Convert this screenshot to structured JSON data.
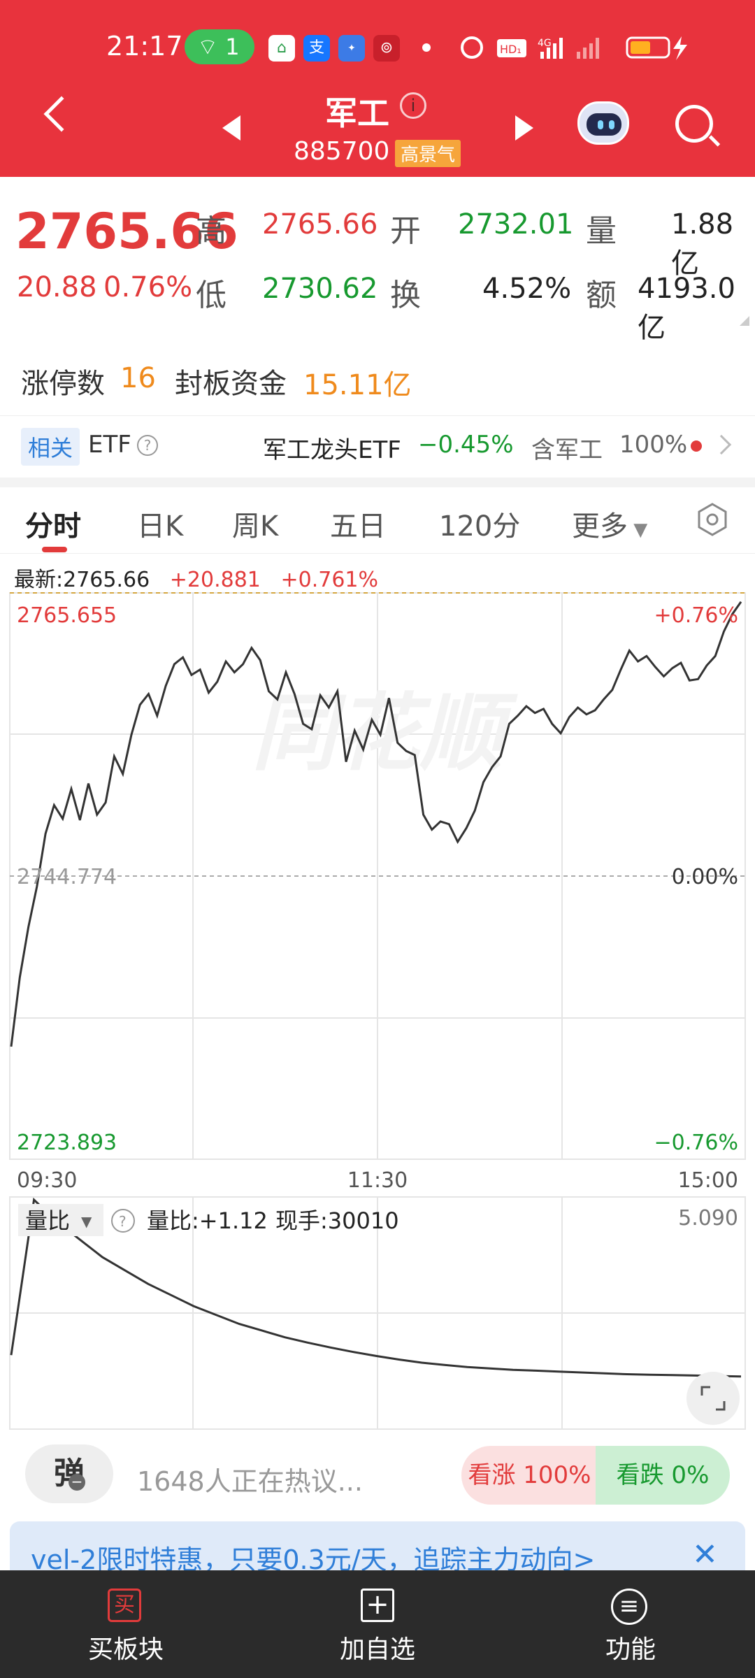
{
  "status_bar": {
    "time": "21:17",
    "wifi_count": "1"
  },
  "header": {
    "title": "军工",
    "code": "885700",
    "tag": "高景气"
  },
  "quote": {
    "price": "2765.66",
    "change": "20.88",
    "change_pct": "0.76%",
    "high_label": "高",
    "high": "2765.66",
    "low_label": "低",
    "low": "2730.62",
    "open_label": "开",
    "open": "2732.01",
    "turnover_label": "换",
    "turnover": "4.52%",
    "volume_label": "量",
    "volume": "1.88亿",
    "amount_label": "额",
    "amount": "4193.0亿"
  },
  "limit_up": {
    "count_label": "涨停数",
    "count": "16",
    "fund_label": "封板资金",
    "fund": "15.11亿"
  },
  "etf": {
    "related_label": "相关",
    "etf_label": "ETF",
    "name": "军工龙头ETF",
    "change": "−0.45%",
    "contains_label": "含军工",
    "contains_pct": "100%"
  },
  "tabs": [
    "分时",
    "日K",
    "周K",
    "五日",
    "120分",
    "更多"
  ],
  "latest": {
    "label": "最新:2765.66",
    "change": "+20.881",
    "pct": "+0.761%"
  },
  "chart_data": [
    {
      "type": "line",
      "title": "分时",
      "x_ticks": [
        "09:30",
        "11:30",
        "15:00"
      ],
      "y_top_label": "2765.655",
      "y_mid_label": "2744.774",
      "y_bottom_label": "2723.893",
      "right_top_label": "+0.76%",
      "right_mid_label": "0.00%",
      "right_bottom_label": "−0.76%",
      "ylim": [
        2723.893,
        2765.655
      ],
      "base": 2744.774,
      "series": [
        {
          "values": [
            2732.2,
            2737.3,
            2741.0,
            2744.0,
            2747.9,
            2750.0,
            2749.0,
            2751.2,
            2748.9,
            2751.6,
            2749.3,
            2750.2,
            2753.6,
            2752.3,
            2755.2,
            2757.4,
            2758.2,
            2756.6,
            2758.8,
            2760.4,
            2760.9,
            2759.6,
            2760.0,
            2758.3,
            2759.1,
            2760.6,
            2759.8,
            2760.4,
            2761.6,
            2760.7,
            2758.4,
            2757.8,
            2759.8,
            2758.2,
            2756.0,
            2755.6,
            2758.1,
            2757.2,
            2758.4,
            2753.2,
            2755.5,
            2754.1,
            2756.3,
            2755.2,
            2757.9,
            2754.6,
            2754.0,
            2753.7,
            2749.3,
            2748.2,
            2748.8,
            2748.6,
            2747.3,
            2748.3,
            2749.6,
            2751.7,
            2752.8,
            2753.6,
            2756.0,
            2756.6,
            2757.3,
            2756.8,
            2757.1,
            2756.0,
            2755.3,
            2756.5,
            2757.2,
            2756.7,
            2757.0,
            2757.8,
            2758.5,
            2760.0,
            2761.4,
            2760.6,
            2761.0,
            2760.2,
            2759.5,
            2760.1,
            2760.5,
            2759.2,
            2759.3,
            2760.3,
            2761.0,
            2762.8,
            2764.1,
            2765.0
          ]
        }
      ]
    },
    {
      "type": "line",
      "title": "量比",
      "ylabel": "量比",
      "info": "量比:+1.12",
      "hand": "现手:30010",
      "max_label": "5.090",
      "ylim": [
        0,
        5.09
      ],
      "series": [
        {
          "values": [
            1.6,
            5.09,
            4.6,
            4.2,
            3.8,
            3.5,
            3.2,
            2.95,
            2.7,
            2.5,
            2.3,
            2.15,
            2.0,
            1.88,
            1.77,
            1.67,
            1.58,
            1.5,
            1.43,
            1.38,
            1.33,
            1.3,
            1.27,
            1.25,
            1.23,
            1.21,
            1.19,
            1.17,
            1.16,
            1.15,
            1.14,
            1.13,
            1.12
          ]
        }
      ]
    }
  ],
  "community": {
    "dan": "弹",
    "hot": "1648人正在热议...",
    "bull": "看涨 100%",
    "bear": "看跌 0%"
  },
  "banner": {
    "text": "vel-2限时特惠，只要0.3元/天，追踪主力动向>"
  },
  "bottom_nav": {
    "buy": "买板块",
    "add": "加自选",
    "func": "功能",
    "buy_icon": "买"
  },
  "colors": {
    "header": "#e8333d",
    "up": "#e23b3b",
    "down": "#17992f",
    "orange": "#ef8a1c"
  }
}
